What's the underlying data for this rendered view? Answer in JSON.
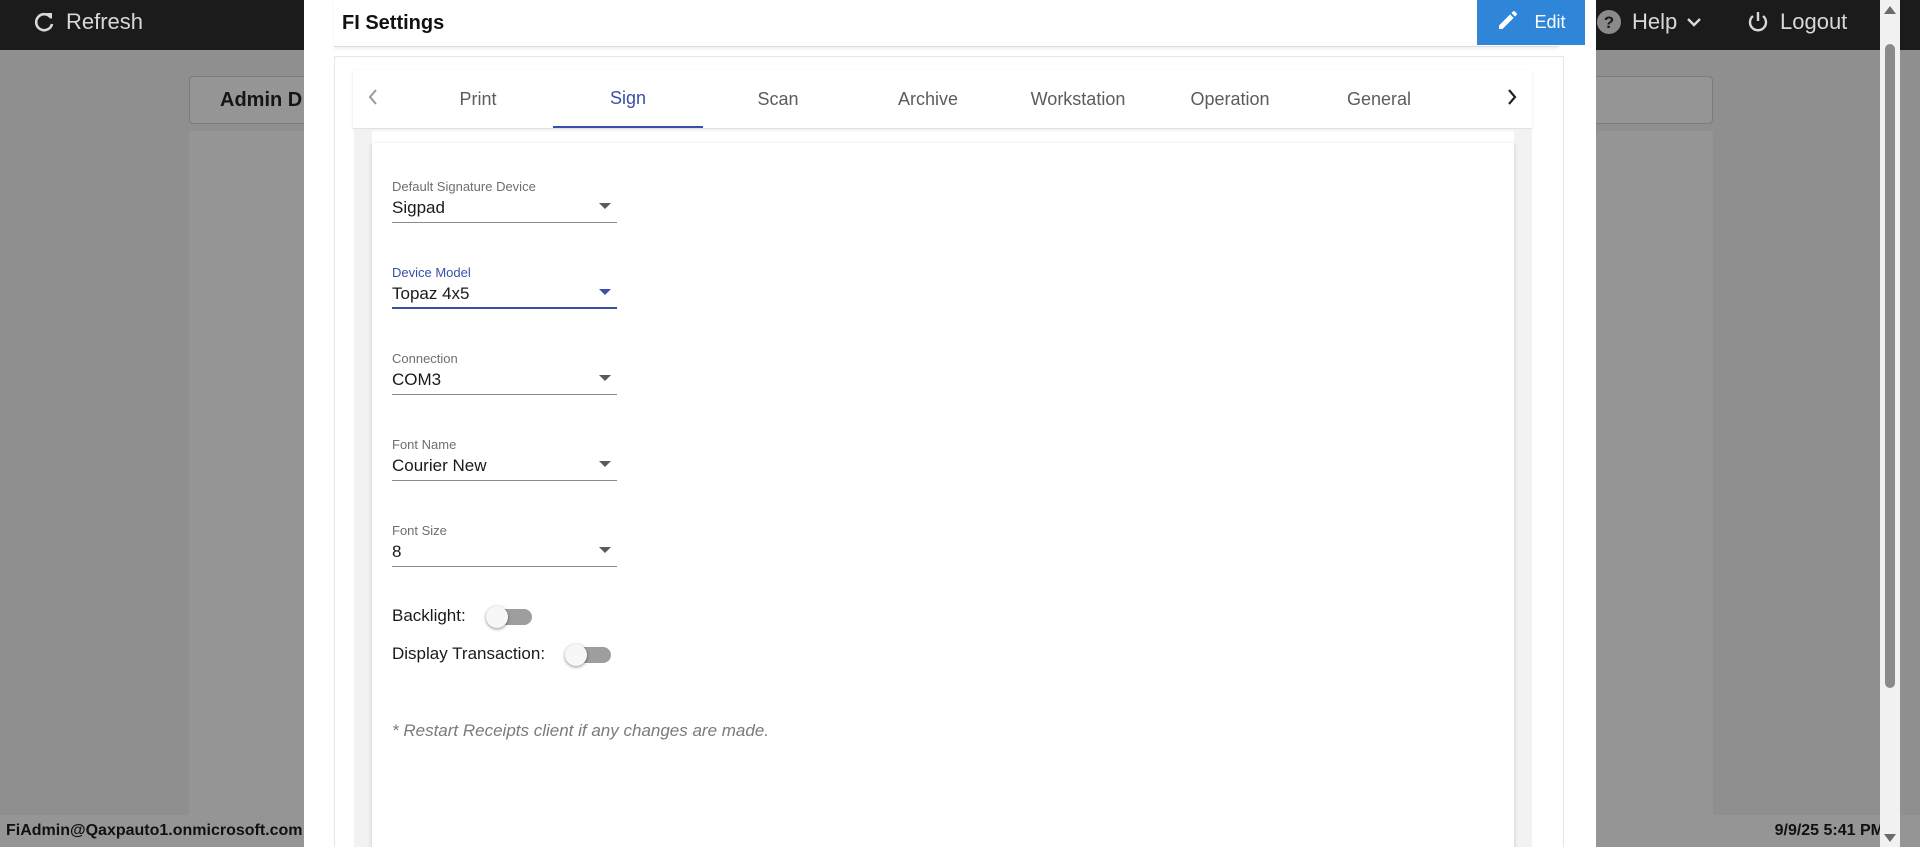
{
  "topbar": {
    "refresh_label": "Refresh",
    "help_label": "Help",
    "logout_label": "Logout"
  },
  "background": {
    "panel_title": "Admin D"
  },
  "dialog": {
    "title": "FI Settings",
    "edit_label": "Edit"
  },
  "tabs": [
    {
      "label": "Print",
      "active": false
    },
    {
      "label": "Sign",
      "active": true
    },
    {
      "label": "Scan",
      "active": false
    },
    {
      "label": "Archive",
      "active": false
    },
    {
      "label": "Workstation",
      "active": false
    },
    {
      "label": "Operation",
      "active": false
    },
    {
      "label": "General",
      "active": false
    }
  ],
  "sign": {
    "fields": [
      {
        "label": "Default Signature Device",
        "value": "Sigpad"
      },
      {
        "label": "Device Model",
        "value": "Topaz 4x5",
        "focused": true
      },
      {
        "label": "Connection",
        "value": "COM3"
      },
      {
        "label": "Font Name",
        "value": "Courier New"
      },
      {
        "label": "Font Size",
        "value": "8"
      }
    ],
    "toggles": [
      {
        "label": "Backlight:",
        "on": false
      },
      {
        "label": "Display Transaction:",
        "on": false
      }
    ],
    "note": "* Restart Receipts client if any changes are made."
  },
  "status": {
    "user": "FiAdmin@Qaxpauto1.onmicrosoft.com",
    "datetime": "9/9/25 5:41 PM"
  },
  "colors": {
    "accent": "#3a4fa8",
    "edit_button": "#2f86d9",
    "topbar": "#1b1b1b"
  }
}
